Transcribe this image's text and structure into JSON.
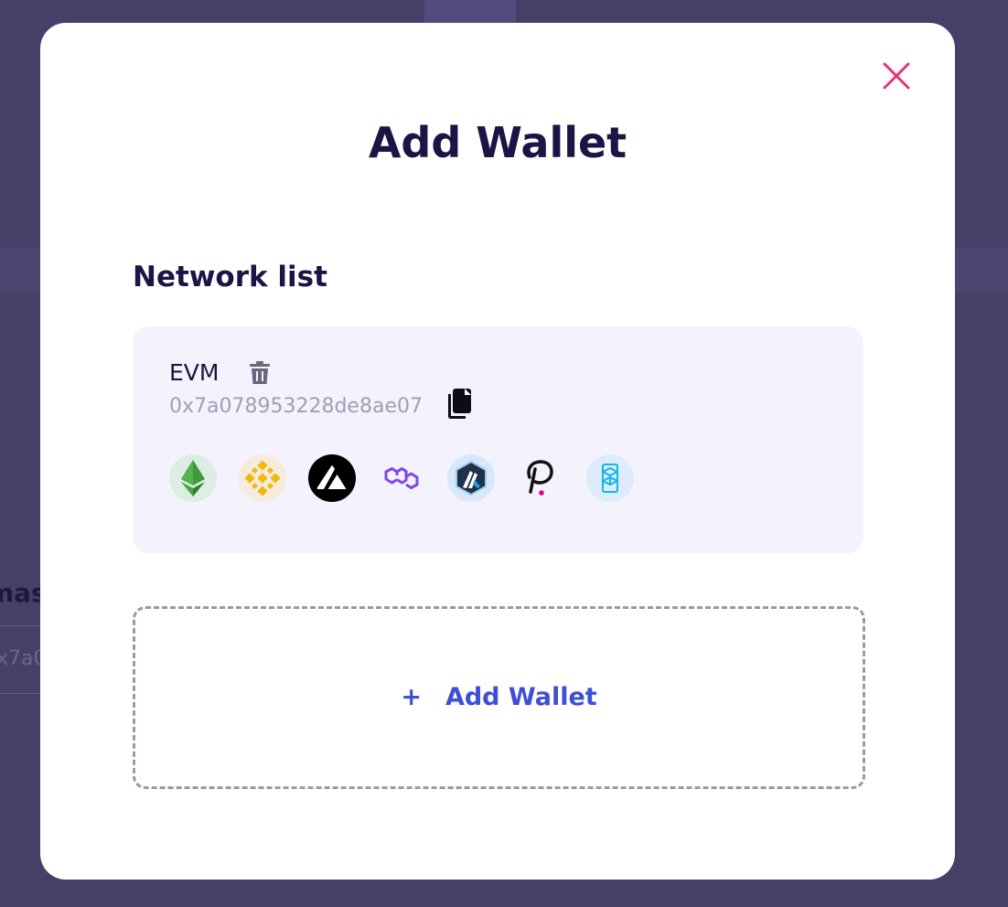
{
  "background": {
    "partial_heading": "mas",
    "partial_address": "x7a0"
  },
  "modal": {
    "title": "Add Wallet",
    "close_icon": "close-icon",
    "accent_color": "#e8317a"
  },
  "network_list": {
    "heading": "Network list",
    "networks": [
      {
        "name": "EVM",
        "address": "0x7a078953228de8ae07",
        "delete_icon": "trash-icon",
        "copy_icon": "copy-icon",
        "chains": [
          {
            "name": "ethereum",
            "icon": "ethereum-icon"
          },
          {
            "name": "bnb",
            "icon": "bnb-icon"
          },
          {
            "name": "avalanche",
            "icon": "avalanche-icon"
          },
          {
            "name": "polygon",
            "icon": "polygon-icon"
          },
          {
            "name": "arbitrum",
            "icon": "arbitrum-icon"
          },
          {
            "name": "polkadot",
            "icon": "polkadot-icon"
          },
          {
            "name": "fantom",
            "icon": "fantom-icon"
          }
        ]
      }
    ]
  },
  "add_wallet": {
    "plus": "+",
    "label": "Add Wallet",
    "color": "#3d4fd6"
  }
}
